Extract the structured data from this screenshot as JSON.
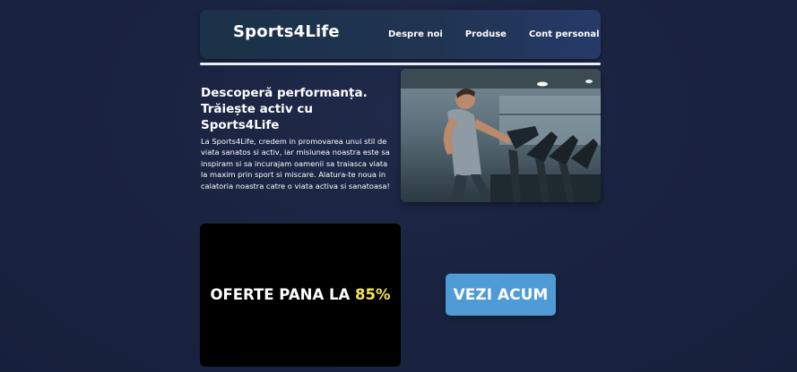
{
  "header": {
    "brand": "Sports4Life",
    "nav": [
      "Despre noi",
      "Produse",
      "Cont personal"
    ]
  },
  "intro": {
    "headline_line1": "Descoperă performanța.",
    "headline_line2": "Trăiește activ cu Sports4Life",
    "paragraph": "La Sports4Life, credem in promovarea unui stil de viata sanatos si activ, iar misiunea noastra este sa inspiram si sa incurajam oamenii sa traiasca viata la maxim prin sport si miscare. Alatura-te noua in calatoria noastra catre o viata activa si sanatoasa!"
  },
  "promo": {
    "text": "OFERTE PANA LA ",
    "percent": "85%",
    "percent_color": "#f1e35a"
  },
  "cta": {
    "label": "VEZI ACUM",
    "color": "#4f9bd6"
  },
  "hero_image": {
    "icon": "treadmill-runner-photo"
  }
}
